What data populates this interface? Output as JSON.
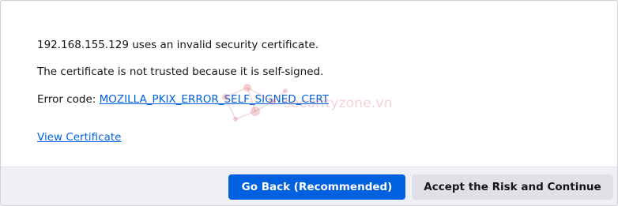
{
  "error": {
    "invalid_line": "192.168.155.129 uses an invalid security certificate.",
    "reason_line": "The certificate is not trusted because it is self-signed.",
    "code_label": "Error code: ",
    "code_value": "MOZILLA_PKIX_ERROR_SELF_SIGNED_CERT",
    "view_certificate": "View Certificate"
  },
  "watermark": {
    "text": "securityzone.vn"
  },
  "buttons": {
    "go_back": "Go Back (Recommended)",
    "accept": "Accept the Risk and Continue"
  },
  "colors": {
    "link": "#0060df",
    "primary_button": "#0061e0",
    "secondary_button": "#e0e0e6",
    "footer_bg": "#f0f0f4"
  }
}
